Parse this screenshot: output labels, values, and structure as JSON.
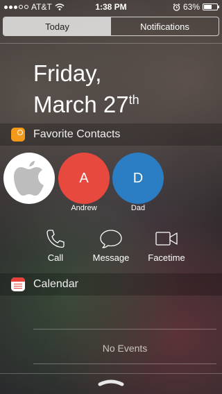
{
  "status_bar": {
    "carrier": "AT&T",
    "time": "1:38 PM",
    "battery": "63%",
    "battery_level": 0.63,
    "signal_bars": 3,
    "signal_total": 5,
    "icons": [
      "wifi-icon",
      "alarm-icon",
      "battery-icon"
    ]
  },
  "tabs": [
    {
      "label": "Today",
      "active": true
    },
    {
      "label": "Notifications",
      "active": false
    }
  ],
  "date": {
    "line1": "Friday,",
    "line2": "March 27",
    "suffix": "th"
  },
  "favorites": {
    "title": "Favorite Contacts",
    "contacts": [
      {
        "initial": "",
        "name": "",
        "color": "#ffffff",
        "icon": "apple-icon"
      },
      {
        "initial": "A",
        "name": "Andrew",
        "color": "#e8493f"
      },
      {
        "initial": "D",
        "name": "Dad",
        "color": "#2b7ec3"
      }
    ],
    "actions": [
      {
        "label": "Call",
        "icon": "phone-icon"
      },
      {
        "label": "Message",
        "icon": "message-icon"
      },
      {
        "label": "Facetime",
        "icon": "video-icon"
      }
    ]
  },
  "calendar": {
    "title": "Calendar",
    "empty_text": "No Events"
  },
  "colors": {
    "fav_icon": "#f39a1b",
    "cal_icon_red": "#e8413c"
  }
}
